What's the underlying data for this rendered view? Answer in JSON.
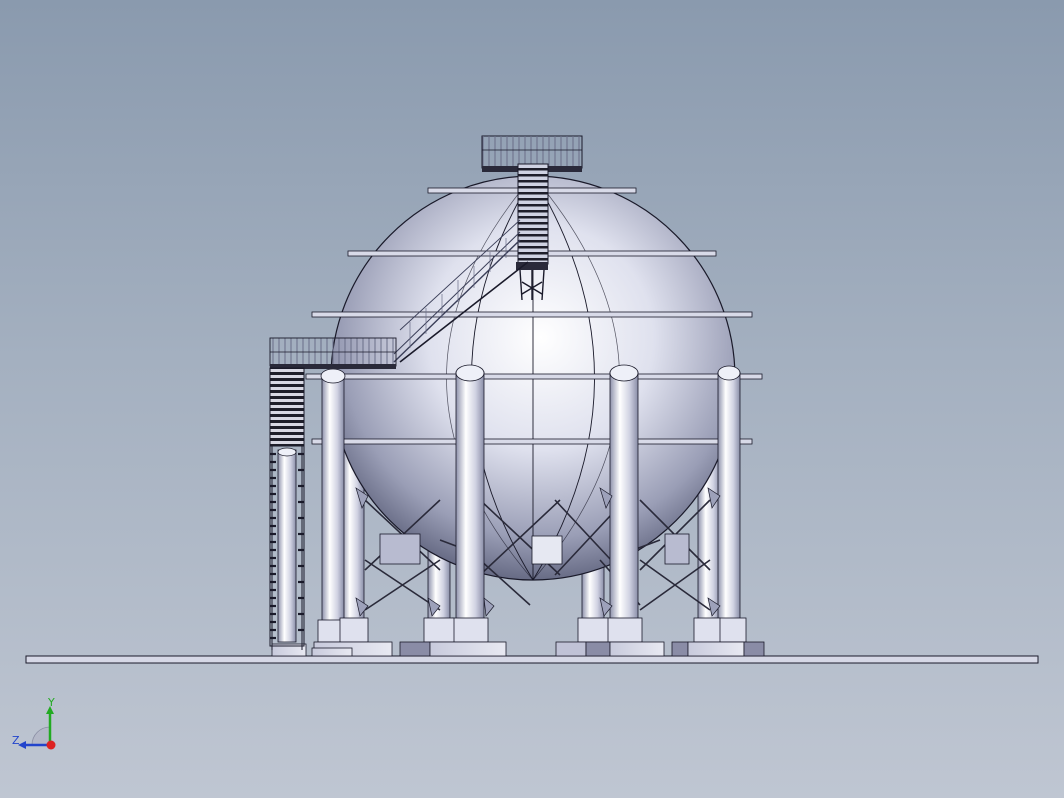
{
  "viewport": {
    "name": "3d-graphics-area",
    "model": "spherical-storage-tank"
  },
  "triad": {
    "y_label": "Y",
    "z_label": "Z",
    "colors": {
      "y": "#22aa22",
      "z": "#2244cc",
      "x": "#dd2222"
    }
  },
  "colors": {
    "background_top": "#8a9aae",
    "background_bottom": "#bfc6d2",
    "sphere_highlight": "#ffffff",
    "sphere_mid": "#c8cce0",
    "sphere_shadow": "#5a5e78",
    "steel": "#d4d6e6",
    "outline": "#1a1a2a"
  }
}
